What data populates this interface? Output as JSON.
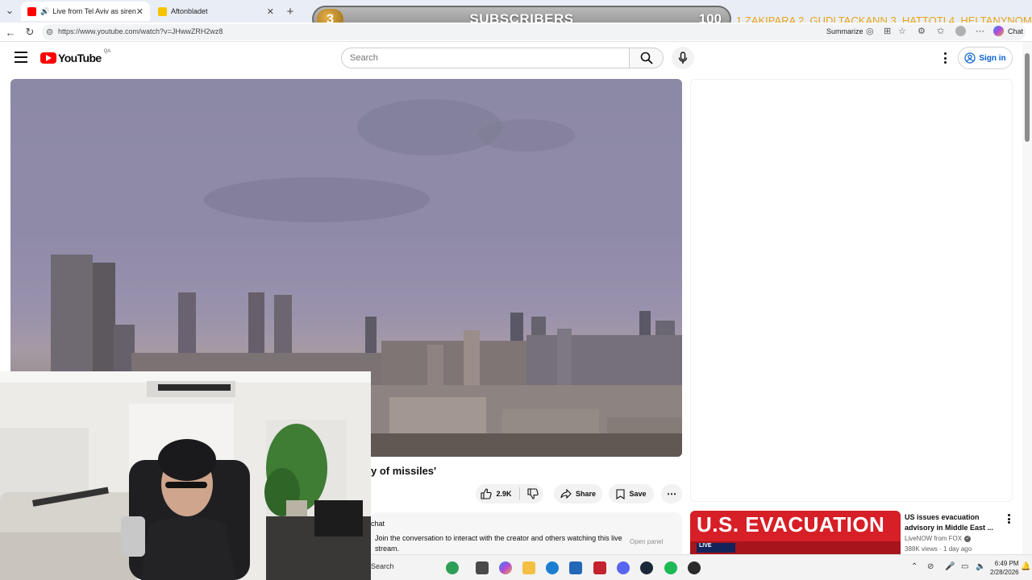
{
  "browser": {
    "tabs": [
      {
        "title": "Live from Tel Aviv as sirens so",
        "active": true
      },
      {
        "title": "Aftonbladet",
        "active": false
      }
    ],
    "url": "https://www.youtube.com/watch?v=JHwwZRH2wz8",
    "summarize_label": "Summarize",
    "chat_label": "Chat"
  },
  "overlay": {
    "subscriber_count": "3",
    "label": "SUBSCRIBERS",
    "goal": "100",
    "ticker": "1.ZAKIPARA 2. GUDLTACKANN  3. HATTOTI 4. HELTANYNOM"
  },
  "youtube": {
    "logo_text": "YouTube",
    "country_code": "QA",
    "search_placeholder": "Search",
    "sign_in_label": "Sign in"
  },
  "video": {
    "title_visible": "y of missiles'",
    "like_count": "2.9K",
    "share_label": "Share",
    "save_label": "Save"
  },
  "chat": {
    "header": "chat",
    "prompt": "Join the conversation to interact with the creator and others watching this live stream.",
    "open_panel_label": "Open panel"
  },
  "recommendation": {
    "thumb_text": "U.S. EVACUATION",
    "thumb_badge": "LIVE",
    "title": "US issues evacuation advisory in Middle East ...",
    "channel": "LiveNOW from FOX",
    "meta": "388K views · 1 day ago"
  },
  "taskbar": {
    "search_label": "Search",
    "time": "6:49 PM",
    "date": "2/28/2026"
  },
  "colors": {
    "youtube_red": "#ff0000",
    "link_blue": "#065fd4",
    "ticker_orange": "#e8a41c",
    "evacuation_red": "#d61f26"
  }
}
